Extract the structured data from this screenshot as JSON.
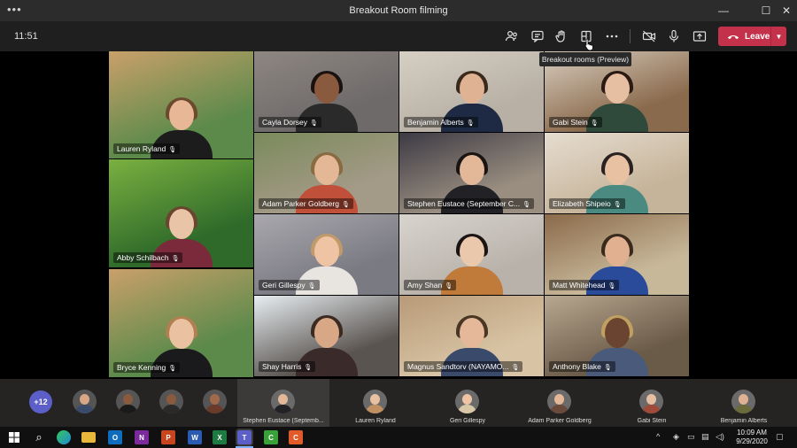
{
  "window": {
    "title": "Breakout Room filming",
    "menu_glyph": "•••",
    "controls": [
      "minimize-icon",
      "maximize-icon",
      "close-icon"
    ]
  },
  "meeting": {
    "elapsed": "11:51",
    "tooltip": "Breakout rooms (Preview)",
    "leave_label": "Leave",
    "toolbar_icons": [
      "participants-icon",
      "chat-icon",
      "raise-hand-icon",
      "breakout-rooms-icon",
      "more-actions-icon",
      "camera-off-icon",
      "microphone-icon",
      "share-tray-icon"
    ]
  },
  "grid": {
    "tiles": [
      {
        "name": "Lauren Ryland",
        "bg": "#5b8a4a",
        "bg2": "#c9a06a",
        "skin": "#e8b896",
        "hair": "#6b4a2e",
        "shirt": "#1c1c1c"
      },
      {
        "name": "Cayla Dorsey",
        "bg": "#6e6a6a",
        "bg2": "#8e8782",
        "skin": "#8a5a3e",
        "hair": "#1a1210",
        "shirt": "#2a2a2a"
      },
      {
        "name": "Benjamin Alberts",
        "bg": "#b8b0a4",
        "bg2": "#d6cfc4",
        "skin": "#e0b294",
        "hair": "#3a2a1c",
        "shirt": "#1e2a44"
      },
      {
        "name": "Gabi Stein",
        "bg": "#8a6a4c",
        "bg2": "#d8cdbf",
        "skin": "#e6bfa2",
        "hair": "#2a1a12",
        "shirt": "#2f4a3a"
      },
      {
        "name": "Adam Parker Goldberg",
        "bg": "#a49a88",
        "bg2": "#7a8a5a",
        "skin": "#e4b896",
        "hair": "#8a6a40",
        "shirt": "#c0503a"
      },
      {
        "name": "Stephen Eustace (September C...",
        "bg": "#9a8e80",
        "bg2": "#3c3a44",
        "skin": "#e2b898",
        "hair": "#1a1412",
        "shirt": "#222226"
      },
      {
        "name": "Elizabeth Shipeio",
        "bg": "#c6b49a",
        "bg2": "#e6ddd0",
        "skin": "#e8c0a2",
        "hair": "#2a2220",
        "shirt": "#4a8a80"
      },
      {
        "name": "Abby Schilbach",
        "bg": "#2f6a2a",
        "bg2": "#7ab040",
        "skin": "#eac4a6",
        "hair": "#6a4630",
        "shirt": "#7a2a3a"
      },
      {
        "name": "Geri Gillespy",
        "bg": "#7a7a82",
        "bg2": "#aaa8ae",
        "skin": "#eec4a4",
        "hair": "#c09a6a",
        "shirt": "#e8e4e0"
      },
      {
        "name": "Amy Shan",
        "bg": "#b8b2aa",
        "bg2": "#d8d4ce",
        "skin": "#eac8ac",
        "hair": "#1a1414",
        "shirt": "#c07a3a"
      },
      {
        "name": "Matt Whitehead",
        "bg": "#c8b89a",
        "bg2": "#8a6a4a",
        "skin": "#e0b090",
        "hair": "#3a2a1e",
        "shirt": "#2a4a9a"
      },
      {
        "name": "Bryce Kenning",
        "bg": "#5b8a4a",
        "bg2": "#c9a06a",
        "skin": "#eac2a2",
        "hair": "#b08050",
        "shirt": "#1a1a1c"
      },
      {
        "name": "Shay Harris",
        "bg": "#5a5450",
        "bg2": "#e8eef2",
        "skin": "#d8a886",
        "hair": "#3a2a20",
        "shirt": "#3a2a2a"
      },
      {
        "name": "Magnus Sandtorv (NAYAMO...",
        "bg": "#d8c4a4",
        "bg2": "#b89a78",
        "skin": "#e4b898",
        "hair": "#4a3624",
        "shirt": "#3a4a6a"
      },
      {
        "name": "Anthony Blake",
        "bg": "#6a5a48",
        "bg2": "#b8a890",
        "skin": "#6a4430",
        "hair": "#c0a060",
        "shirt": "#4a5a7a"
      }
    ]
  },
  "strip": {
    "more_count": "+12",
    "avatars": [
      {
        "skin": "#d8a886",
        "shirt": "#3a4a6a"
      },
      {
        "skin": "#8a5a3e",
        "shirt": "#1a1a1a"
      },
      {
        "skin": "#8a5a3e",
        "shirt": "#2a2a2a"
      },
      {
        "skin": "#a06a4a",
        "shirt": "#6a3a2a"
      }
    ],
    "participants": [
      {
        "name": "Stephen Eustace (Septemb...",
        "skin": "#e2b898",
        "shirt": "#222226"
      },
      {
        "name": "Lauren Ryland",
        "skin": "#e8c0a2",
        "shirt": "#c09060"
      },
      {
        "name": "Geri Gillespy",
        "skin": "#eec4a4",
        "shirt": "#d8c8a8"
      },
      {
        "name": "Adam Parker Goldberg",
        "skin": "#e4b896",
        "shirt": "#6a4a3a"
      },
      {
        "name": "Gabi Stein",
        "skin": "#e6bfa2",
        "shirt": "#a04a3a"
      },
      {
        "name": "Benjamin Alberts",
        "skin": "#e0b294",
        "shirt": "#6a6a3a"
      }
    ]
  },
  "taskbar": {
    "apps": [
      {
        "icon": "windows-start-icon",
        "color": "#ffffff",
        "glyph": ""
      },
      {
        "icon": "search-icon",
        "color": "",
        "glyph": "⌕"
      },
      {
        "icon": "edge-icon",
        "color": "#1f8ad6",
        "glyph": ""
      },
      {
        "icon": "file-explorer-icon",
        "color": "#e8b83a",
        "glyph": ""
      },
      {
        "icon": "outlook-icon",
        "color": "#0f6cbd",
        "glyph": "O"
      },
      {
        "icon": "onenote-icon",
        "color": "#7a2a9a",
        "glyph": "N"
      },
      {
        "icon": "powerpoint-icon",
        "color": "#c8451f",
        "glyph": "P"
      },
      {
        "icon": "word-icon",
        "color": "#2a5bb0",
        "glyph": "W"
      },
      {
        "icon": "excel-icon",
        "color": "#1e7a42",
        "glyph": "X"
      },
      {
        "icon": "teams-icon",
        "color": "#5b5fc7",
        "glyph": "T"
      },
      {
        "icon": "camtasia-icon",
        "color": "#3aa03a",
        "glyph": "C"
      },
      {
        "icon": "camtasia-recorder-icon",
        "color": "#e05a2a",
        "glyph": "C"
      }
    ],
    "time": "10:09 AM",
    "date": "9/29/2020"
  }
}
